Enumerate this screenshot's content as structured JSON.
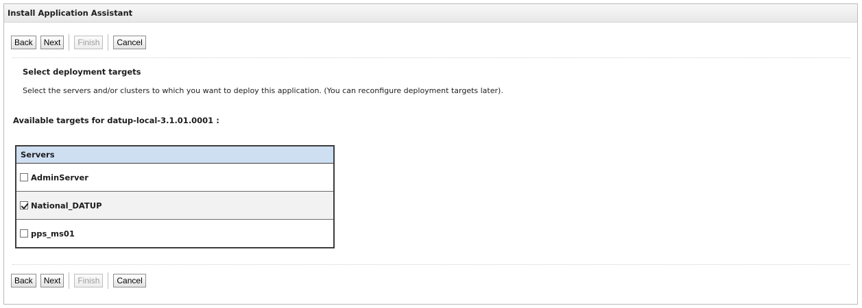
{
  "window": {
    "title": "Install Application Assistant"
  },
  "buttons": {
    "back": "Back",
    "next": "Next",
    "finish": "Finish",
    "cancel": "Cancel"
  },
  "step": {
    "title": "Select deployment targets",
    "description": "Select the servers and/or clusters to which you want to deploy this application. (You can reconfigure deployment targets later)."
  },
  "targets": {
    "heading": "Available targets for datup-local-3.1.01.0001 :",
    "table_header": "Servers",
    "servers": [
      {
        "name": "AdminServer",
        "checked": false
      },
      {
        "name": "National_DATUP",
        "checked": true
      },
      {
        "name": "pps_ms01",
        "checked": false
      }
    ]
  },
  "colors": {
    "header_bg": "#cfdff2",
    "selected_row_bg": "#f2f2f2",
    "disabled_text": "#9b9b9b"
  }
}
